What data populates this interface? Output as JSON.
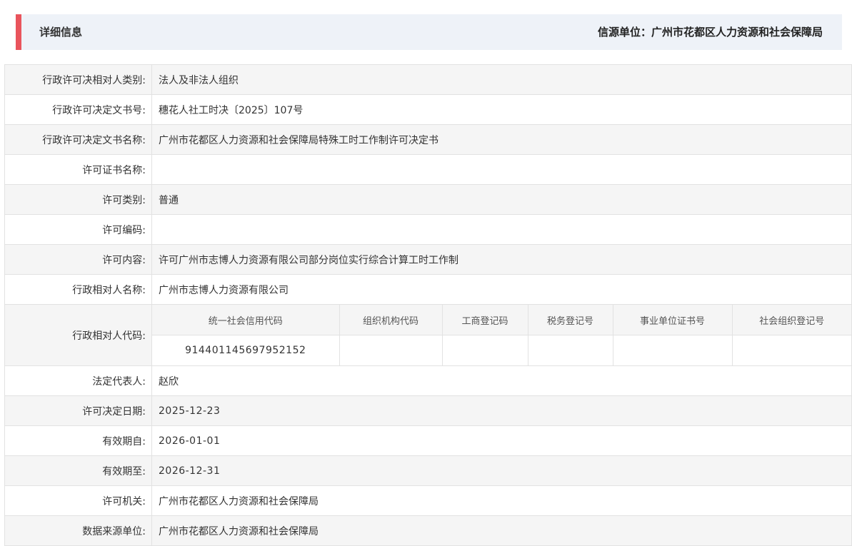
{
  "header": {
    "title": "详细信息",
    "source_label": "信源单位：",
    "source_value": "广州市花都区人力资源和社会保障局",
    "accent_color": "#e9545c"
  },
  "rows": {
    "r1": {
      "label": "行政许可决相对人类别:",
      "value": "法人及非法人组织"
    },
    "r2": {
      "label": "行政许可决定文书号:",
      "value": "穗花人社工时决〔2025〕107号"
    },
    "r3": {
      "label": "行政许可决定文书名称:",
      "value": "广州市花都区人力资源和社会保障局特殊工时工作制许可决定书"
    },
    "r4": {
      "label": "许可证书名称:",
      "value": ""
    },
    "r5": {
      "label": "许可类别:",
      "value": "普通"
    },
    "r6": {
      "label": "许可编码:",
      "value": ""
    },
    "r7": {
      "label": "许可内容:",
      "value": "许可广州市志博人力资源有限公司部分岗位实行综合计算工时工作制"
    },
    "r8": {
      "label": "行政相对人名称:",
      "value": "广州市志博人力资源有限公司"
    },
    "r9": {
      "label": "行政相对人代码:"
    },
    "r10": {
      "label": "法定代表人:",
      "value": "赵欣"
    },
    "r11": {
      "label": "许可决定日期:",
      "value": "2025-12-23"
    },
    "r12": {
      "label": "有效期自:",
      "value": "2026-01-01"
    },
    "r13": {
      "label": "有效期至:",
      "value": "2026-12-31"
    },
    "r14": {
      "label": "许可机关:",
      "value": "广州市花都区人力资源和社会保障局"
    },
    "r15": {
      "label": "数据来源单位:",
      "value": "广州市花都区人力资源和社会保障局"
    }
  },
  "codes": {
    "headers": [
      "统一社会信用代码",
      "组织机构代码",
      "工商登记码",
      "税务登记号",
      "事业单位证书号",
      "社会组织登记号"
    ],
    "values": [
      "914401145697952152",
      "",
      "",
      "",
      "",
      ""
    ]
  }
}
